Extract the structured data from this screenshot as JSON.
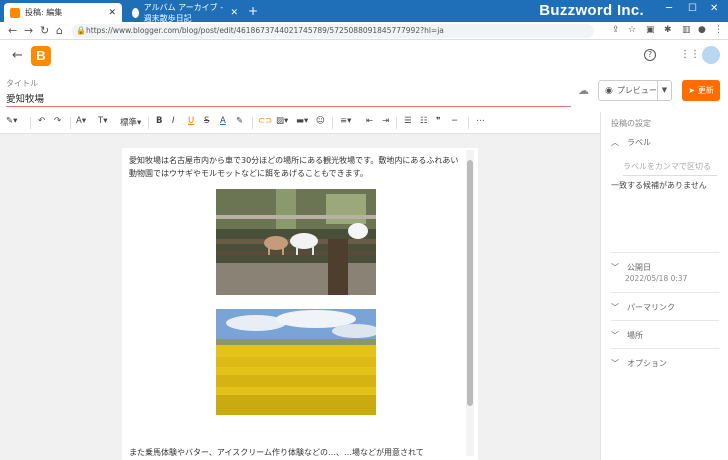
{
  "browser": {
    "tabs": [
      {
        "title": "投稿: 編集",
        "active": true,
        "favicon_color": "#ff8a00"
      },
      {
        "title": "アルバム アーカイブ - 週末散歩日記",
        "active": false,
        "favicon_color": "#ffffff"
      }
    ],
    "brand": "Buzzword Inc.",
    "url": "https://www.blogger.com/blog/post/edit/4618673744021745789/5725088091845777992?hl=ja"
  },
  "editor": {
    "title_label": "タイトル",
    "title_value": "愛知牧場",
    "preview_label": "プレビュー",
    "update_label": "更新",
    "toolbar": {
      "paragraph_style": "標準"
    },
    "body_text": "愛知牧場は名古屋市内から車で30分ほどの場所にある観光牧場です。敷地内にあるふれあい動物園ではウサギやモルモットなどに餌をあげることもできます。",
    "footer_text": "また乗馬体験やバター、アイスクリーム作り体験などの…、…場などが用意されて"
  },
  "sidebar": {
    "heading": "投稿の設定",
    "label_section": "ラベル",
    "label_placeholder": "ラベルをカンマで区切る",
    "no_match": "一致する候補がありません",
    "published": "公開日",
    "published_value": "2022/05/18 0:37",
    "permalink": "パーマリンク",
    "location": "場所",
    "options": "オプション"
  },
  "colors": {
    "accent": "#ff6d00",
    "title_underline": "#e57373",
    "chrome_blue": "#1f6fb8"
  }
}
